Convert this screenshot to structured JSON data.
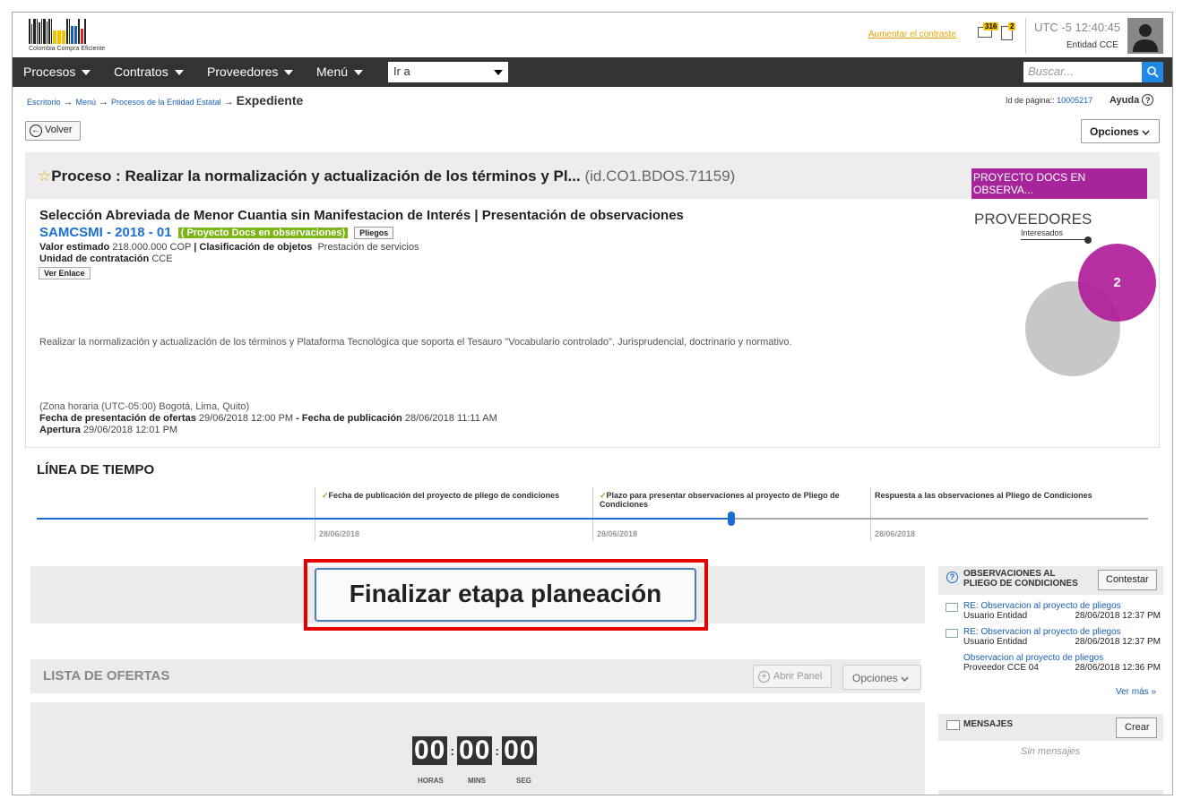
{
  "header": {
    "logo_caption": "Colombia Compra Eficiente",
    "contrast_link": "Aumentar el contraste",
    "mail_count": "316",
    "doc_count": "2",
    "timezone": "UTC -5",
    "clock": "12:40:45",
    "entity": "Entidad CCE"
  },
  "nav": {
    "items": [
      "Procesos",
      "Contratos",
      "Proveedores",
      "Menú"
    ],
    "goto_label": "Ir a",
    "search_placeholder": "Buscar..."
  },
  "breadcrumb": {
    "items": [
      "Escritorio",
      "Menú",
      "Procesos de la Entidad Estatal"
    ],
    "current": "Expediente",
    "separator": "→"
  },
  "page_id": {
    "label": "Id de página::",
    "value": "10005217"
  },
  "help_label": "Ayuda",
  "back_label": "Volver",
  "options_label": "Opciones",
  "process": {
    "title": "Proceso : Realizar la normalización y actualización de los términos y Pl...",
    "id": "(id.CO1.BDOS.71159)",
    "state_badge": "PROYECTO DOCS EN OBSERVA...",
    "modality": "Selección Abreviada de Menor Cuantia sin Manifestacion de Interés | Presentación de observaciones",
    "reference": "SAMCSMI - 2018 - 01",
    "phase_badge": "( Proyecto Docs en observaciones)",
    "pliegos_label": "Pliegos",
    "valor_label": "Valor estimado",
    "valor_value": "218.000.000 COP",
    "clasif_label": "Clasificación de objetos",
    "clasif_value": "Prestación de servicios",
    "unidad_label": "Unidad de contratación",
    "unidad_value": "CCE",
    "ver_enlace": "Ver Enlace",
    "description": "Realizar la normalización y actualización de los términos y Plataforma Tecnológica que soporta el Tesauro \"Vocabulario controlado\". Jurisprudencial, doctrinario y normativo.",
    "timezone_note": "(Zona horaria (UTC-05:00) Bogotá, Lima, Quito)",
    "fecha_ofertas_label": "Fecha de presentación de ofertas",
    "fecha_ofertas_value": "29/06/2018 12:00 PM",
    "fecha_pub_label": "Fecha de publicación",
    "fecha_pub_value": "28/06/2018 11:11 AM",
    "apertura_label": "Apertura",
    "apertura_value": "29/06/2018 12:01 PM"
  },
  "providers": {
    "title": "PROVEEDORES",
    "subtitle": "Interesados",
    "count": "2"
  },
  "timeline": {
    "title": "LÍNEA DE TIEMPO",
    "events": [
      {
        "label": "Fecha de publicación del proyecto de pliego de condiciones",
        "date": "28/06/2018",
        "done": "✓"
      },
      {
        "label": "Plazo para presentar observaciones al proyecto de Pliego de Condiciones",
        "date": "28/06/2018",
        "done": "✓"
      },
      {
        "label": "Respuesta a las observaciones al Pliego de Condiciones",
        "date": "28/06/2018",
        "done": ""
      }
    ],
    "progress": 0.63
  },
  "finalize_button": "Finalizar etapa planeación",
  "offers": {
    "title": "LISTA DE OFERTAS",
    "open_panel": "Abrir Panel",
    "options": "Opciones",
    "timer": {
      "hours": "00",
      "mins": "00",
      "secs": "00",
      "labels": [
        "HORAS",
        "MINS",
        "SEG"
      ]
    }
  },
  "observations": {
    "title": "OBSERVACIONES AL PLIEGO DE CONDICIONES",
    "reply_button": "Contestar",
    "items": [
      {
        "subject": "RE: Observacion al proyecto de pliegos",
        "user": "Usuario Entidad",
        "date": "28/06/2018 12:37 PM"
      },
      {
        "subject": "RE: Observacion al proyecto de pliegos",
        "user": "Usuario Entidad",
        "date": "28/06/2018 12:37 PM"
      },
      {
        "subject": "Observacion al proyecto de pliegos",
        "user": "Proveedor CCE 04",
        "date": "28/06/2018 12:36 PM"
      }
    ],
    "more": "Ver más »"
  },
  "messages": {
    "title": "MENSAJES",
    "create_button": "Crear",
    "empty": "Sin mensajes"
  }
}
